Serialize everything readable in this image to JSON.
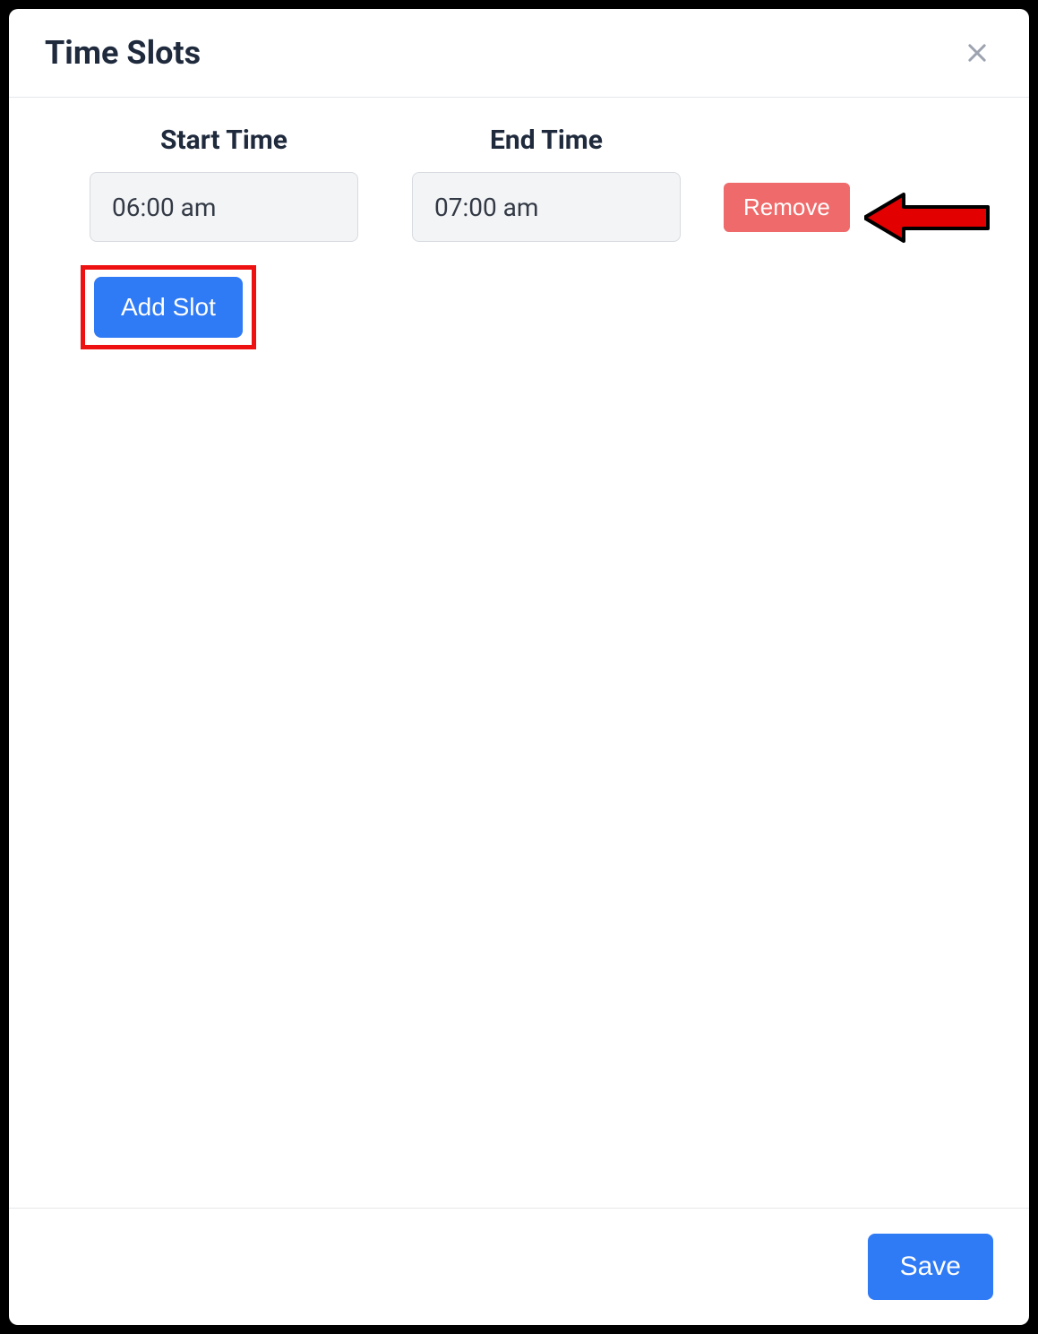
{
  "modal": {
    "title": "Time Slots",
    "columns": {
      "start": "Start Time",
      "end": "End Time"
    },
    "slots": [
      {
        "start": "06:00 am",
        "end": "07:00 am",
        "remove_label": "Remove"
      }
    ],
    "add_slot_label": "Add Slot",
    "save_label": "Save"
  }
}
